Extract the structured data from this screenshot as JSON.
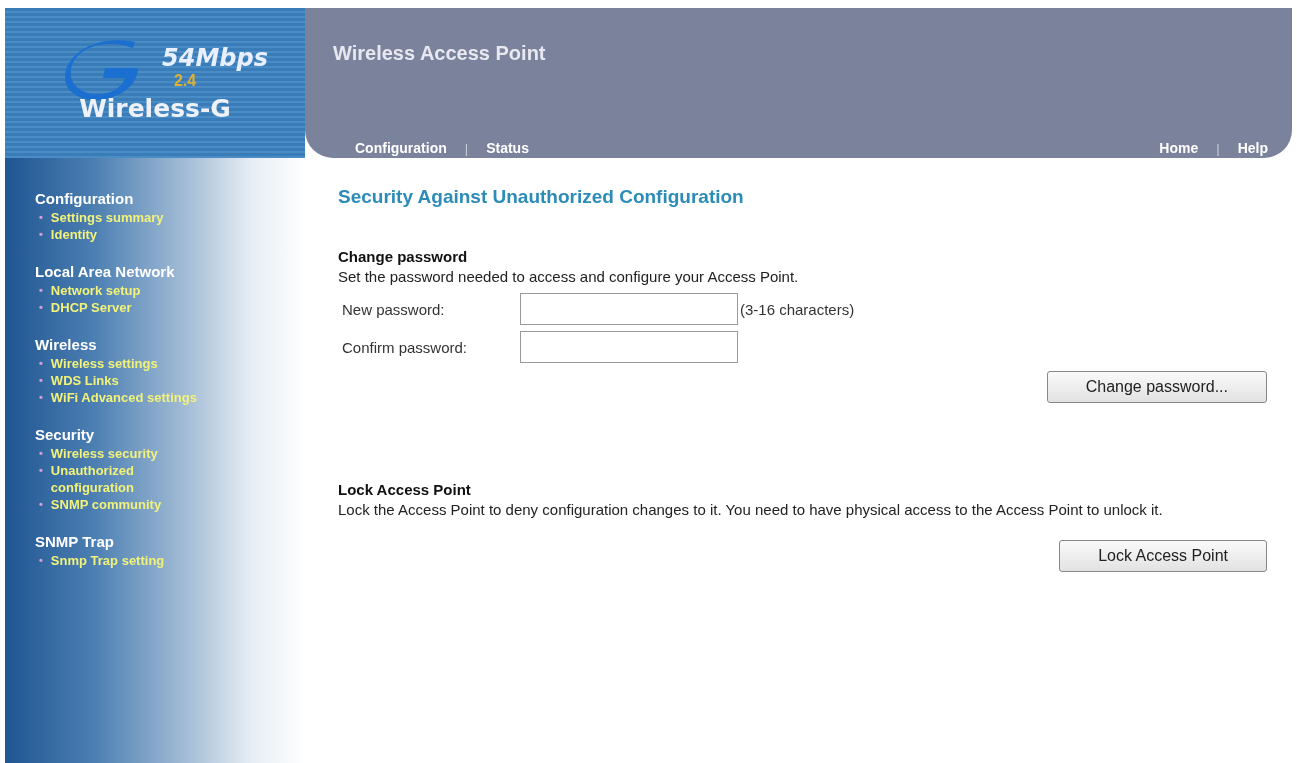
{
  "logo": {
    "speed": "54Mbps",
    "band": "2.4",
    "name": "Wireless-G"
  },
  "header": {
    "title": "Wireless Access Point",
    "nav_left": [
      "Configuration",
      "Status"
    ],
    "nav_right": [
      "Home",
      "Help"
    ],
    "separator": "|"
  },
  "sidebar": {
    "bullet": "•",
    "groups": [
      {
        "title": "Configuration",
        "items": [
          "Settings summary",
          "Identity"
        ]
      },
      {
        "title": "Local Area Network",
        "items": [
          "Network setup",
          "DHCP Server"
        ]
      },
      {
        "title": "Wireless",
        "items": [
          "Wireless settings",
          "WDS Links",
          "WiFi Advanced settings"
        ]
      },
      {
        "title": "Security",
        "items": [
          "Wireless security",
          "Unauthorized configuration",
          "SNMP community"
        ]
      },
      {
        "title": "SNMP Trap",
        "items": [
          "Snmp Trap setting"
        ]
      }
    ]
  },
  "page_title": "Security Against Unauthorized Configuration",
  "change_password": {
    "heading": "Change password",
    "description": "Set the password needed to access and configure your Access Point.",
    "fields": [
      {
        "label": "New password:",
        "hint": "(3-16 characters)"
      },
      {
        "label": "Confirm password:"
      }
    ],
    "button": "Change password..."
  },
  "lock": {
    "heading": "Lock Access Point",
    "description": "Lock the Access Point to deny configuration changes to it. You need to have physical access to the Access Point to unlock it.",
    "button": "Lock Access Point"
  }
}
